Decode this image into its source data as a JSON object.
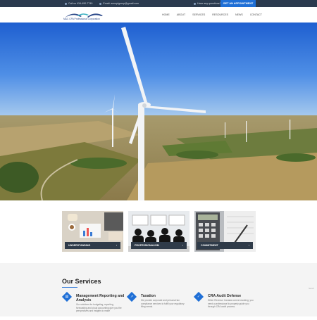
{
  "topbar": {
    "phone": "Call us 416-490-7749",
    "email": "Email: aocoplgroup@gmail.com",
    "question": "Have any questions?",
    "appointment": "GET AN APPOINTMENT"
  },
  "header": {
    "logo_tagline": "M&C CPA Professional Corporation",
    "nav": [
      "HOME",
      "ABOUT",
      "SERVICES",
      "RESOURCES",
      "NEWS",
      "CONTACT"
    ]
  },
  "cards": [
    {
      "label": "UNDERSTANDING"
    },
    {
      "label": "PROFESSIONALISM"
    },
    {
      "label": "COMMITMENT"
    }
  ],
  "services": {
    "heading": "Our Services",
    "items": [
      {
        "title": "Management Reporting and Analysis",
        "desc": "Our solutions for budgeting, reporting, forecasting and cloud accounting give you the perspectives and insights to make"
      },
      {
        "title": "Taxation",
        "desc": "We provide corporate and personal tax compliance services to fulfill your regulatory filing needs."
      },
      {
        "title": "CRA Audit Defense",
        "desc": "When Revenue Canada comes knocking, you need a professional to properly guide you through CRA audit process."
      }
    ]
  },
  "colors": {
    "accent": "#1f6fd6",
    "topbar": "#2b3a4e",
    "label_bg": "#2f3b49"
  },
  "scroll_hint": "Scroll"
}
